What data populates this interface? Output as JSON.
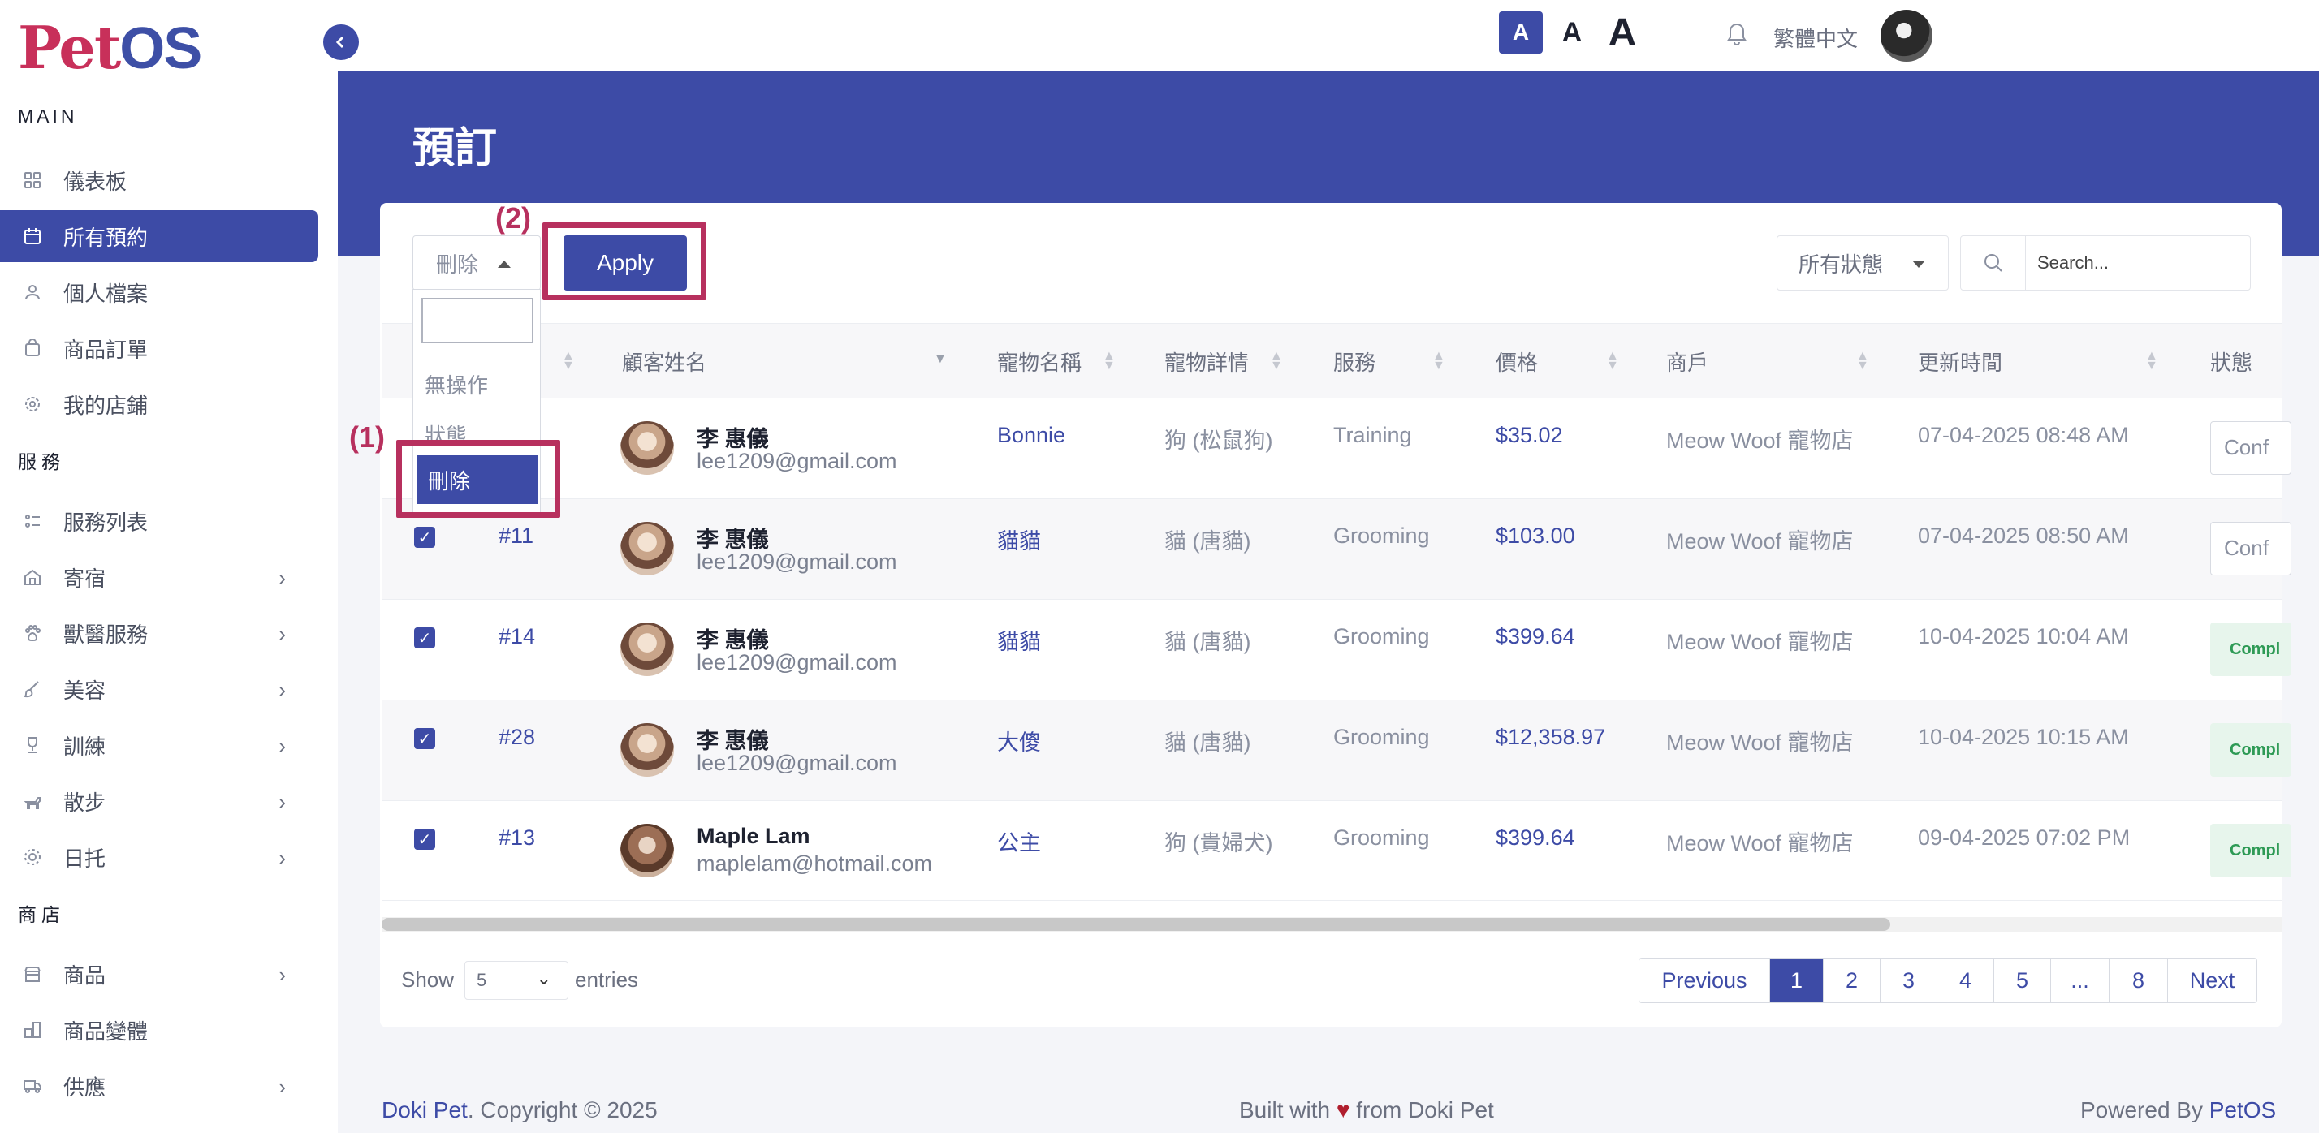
{
  "app": {
    "logo_part1": "Pet",
    "logo_part2": "OS"
  },
  "sidebar": {
    "section_main": "MAIN",
    "section_services": "服務",
    "section_shop": "商店",
    "items": [
      {
        "label": "儀表板",
        "icon": "grid-icon"
      },
      {
        "label": "所有預約",
        "icon": "calendar-icon",
        "active": true
      },
      {
        "label": "個人檔案",
        "icon": "user-icon"
      },
      {
        "label": "商品訂單",
        "icon": "bag-icon"
      },
      {
        "label": "我的店鋪",
        "icon": "settings-icon"
      },
      {
        "label": "服務列表",
        "icon": "list-icon"
      },
      {
        "label": "寄宿",
        "icon": "home-icon"
      },
      {
        "label": "獸醫服務",
        "icon": "paw-icon"
      },
      {
        "label": "美容",
        "icon": "brush-icon"
      },
      {
        "label": "訓練",
        "icon": "trophy-icon"
      },
      {
        "label": "散步",
        "icon": "dog-icon"
      },
      {
        "label": "日托",
        "icon": "sun-icon"
      },
      {
        "label": "商品",
        "icon": "store-icon"
      },
      {
        "label": "商品變體",
        "icon": "variant-icon"
      },
      {
        "label": "供應",
        "icon": "truck-icon"
      }
    ]
  },
  "topbar": {
    "font_small": "A",
    "font_mid": "A",
    "font_big": "A",
    "language": "繁體中文"
  },
  "page": {
    "title": "預訂"
  },
  "toolbar": {
    "bulk_selected": "刪除",
    "apply_label": "Apply",
    "status_filter": "所有狀態",
    "search_placeholder": "Search...",
    "annotation_1": "(1)",
    "annotation_2": "(2)"
  },
  "bulk_dropdown": {
    "options": [
      "無操作",
      "狀態",
      "刪除"
    ],
    "selected": "刪除"
  },
  "table": {
    "headers": [
      "顧客姓名",
      "寵物名稱",
      "寵物詳情",
      "服務",
      "價格",
      "商戶",
      "更新時間",
      "狀態"
    ],
    "rows": [
      {
        "id": "",
        "name": "李 惠儀",
        "email": "lee1209@gmail.com",
        "pet": "Bonnie",
        "detail": "狗 (松鼠狗)",
        "service": "Training",
        "price": "$35.02",
        "merchant": "Meow Woof 寵物店",
        "updated": "07-04-2025 08:48 AM",
        "status": "Conf"
      },
      {
        "id": "#11",
        "name": "李 惠儀",
        "email": "lee1209@gmail.com",
        "pet": "貓貓",
        "detail": "貓 (唐貓)",
        "service": "Grooming",
        "price": "$103.00",
        "merchant": "Meow Woof 寵物店",
        "updated": "07-04-2025 08:50 AM",
        "status": "Conf"
      },
      {
        "id": "#14",
        "name": "李 惠儀",
        "email": "lee1209@gmail.com",
        "pet": "貓貓",
        "detail": "貓 (唐貓)",
        "service": "Grooming",
        "price": "$399.64",
        "merchant": "Meow Woof 寵物店",
        "updated": "10-04-2025 10:04 AM",
        "status": "Compl"
      },
      {
        "id": "#28",
        "name": "李 惠儀",
        "email": "lee1209@gmail.com",
        "pet": "大傻",
        "detail": "貓 (唐貓)",
        "service": "Grooming",
        "price": "$12,358.97",
        "merchant": "Meow Woof 寵物店",
        "updated": "10-04-2025 10:15 AM",
        "status": "Compl"
      },
      {
        "id": "#13",
        "name": "Maple Lam",
        "email": "maplelam@hotmail.com",
        "pet": "公主",
        "detail": "狗 (貴婦犬)",
        "service": "Grooming",
        "price": "$399.64",
        "merchant": "Meow Woof 寵物店",
        "updated": "09-04-2025 07:02 PM",
        "status": "Compl"
      }
    ]
  },
  "pagination": {
    "show_label": "Show",
    "page_size": "5",
    "entries_label": "entries",
    "previous": "Previous",
    "pages": [
      "1",
      "2",
      "3",
      "4",
      "5",
      "...",
      "8"
    ],
    "next": "Next",
    "current": "1"
  },
  "footer": {
    "brand_left": "Doki Pet",
    "copyright": ". Copyright © 2025",
    "built_with": "Built with",
    "heart": "♥",
    "from": "from Doki Pet",
    "powered_by": "Powered By",
    "brand_right": "PetOS"
  },
  "colors": {
    "primary": "#3d4ba6",
    "annotation": "#b7305e",
    "completed_bg": "#e7f5ec",
    "completed_text": "#2e9a55"
  }
}
